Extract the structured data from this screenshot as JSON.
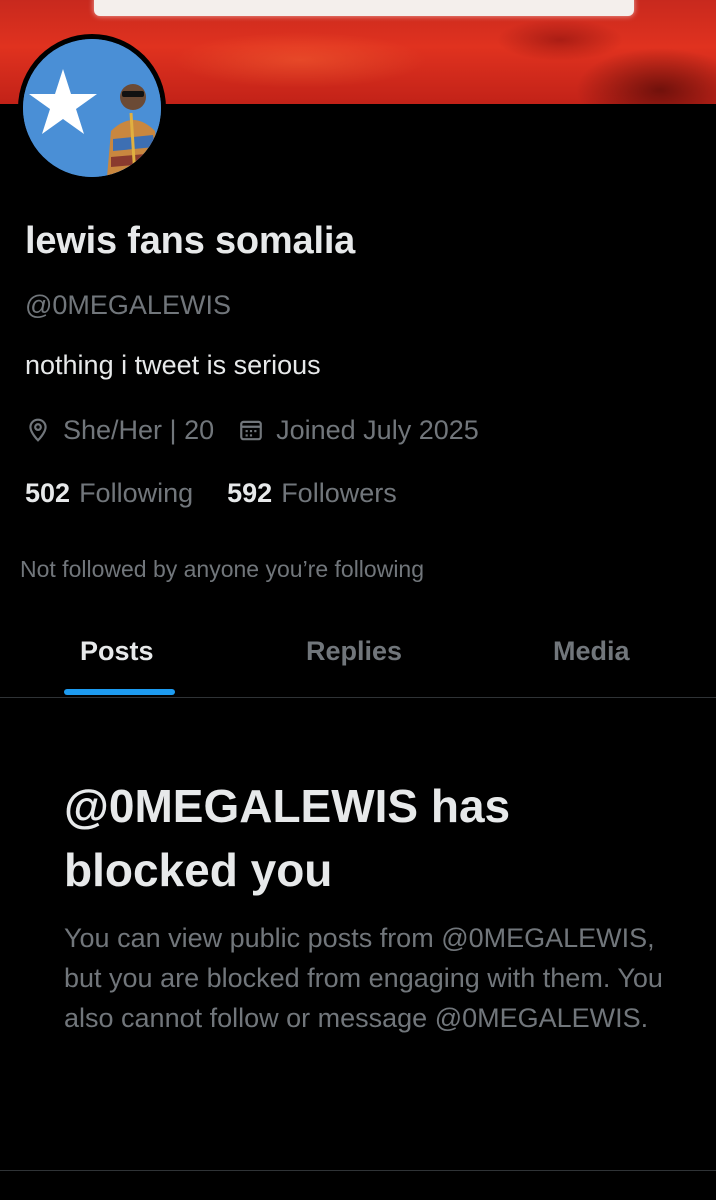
{
  "profile": {
    "display_name": "lewis fans somalia",
    "handle": "@0MEGALEWIS",
    "bio": "nothing i tweet is serious",
    "location": "She/Her | 20",
    "joined": "Joined July 2025",
    "following_count": "502",
    "following_label": "Following",
    "followers_count": "592",
    "followers_label": "Followers",
    "mutuals_note": "Not followed by anyone you’re following"
  },
  "icons": {
    "location": "location-pin-icon",
    "joined": "calendar-icon"
  },
  "tabs": [
    {
      "label": "Posts",
      "active": true
    },
    {
      "label": "Replies",
      "active": false
    },
    {
      "label": "Media",
      "active": false
    }
  ],
  "blocked": {
    "title": "@0MEGALEWIS has blocked you",
    "body": "You can view public posts from @0MEGALEWIS, but you are blocked from engaging with them. You also cannot follow or message @0MEGALEWIS."
  },
  "colors": {
    "background": "#000000",
    "primary_text": "#e7e9ea",
    "secondary_text": "#71767b",
    "accent": "#1d9bf0",
    "divider": "#2f3336",
    "banner": "#d42b1d"
  }
}
